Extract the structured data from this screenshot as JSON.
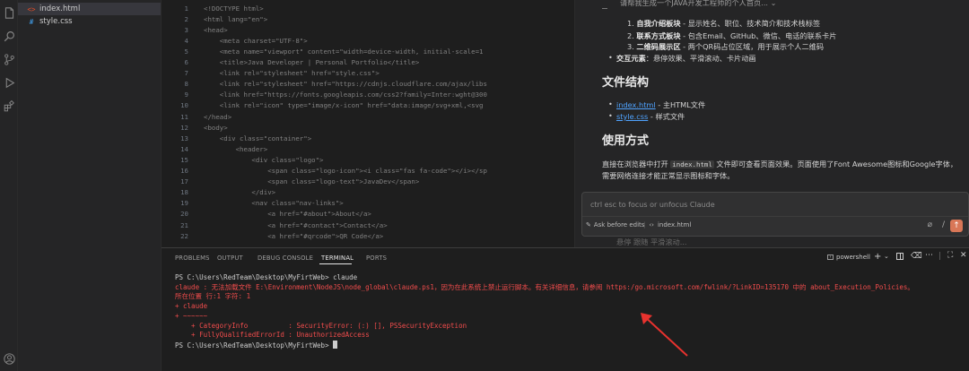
{
  "activity_bar": {
    "icons": [
      "files-icon",
      "search-icon",
      "source-control-icon",
      "run-debug-icon",
      "extensions-icon",
      "account-icon"
    ]
  },
  "explorer": {
    "files": [
      {
        "icon": "<>",
        "name": "index.html"
      },
      {
        "icon": "#",
        "name": "style.css"
      }
    ]
  },
  "editor": {
    "lines": [
      {
        "n": "1",
        "code": "<!DOCTYPE html>"
      },
      {
        "n": "2",
        "code": "<html lang=\"en\">"
      },
      {
        "n": "3",
        "code": "<head>"
      },
      {
        "n": "4",
        "code": "    <meta charset=\"UTF-8\">"
      },
      {
        "n": "5",
        "code": "    <meta name=\"viewport\" content=\"width=device-width, initial-scale=1"
      },
      {
        "n": "6",
        "code": "    <title>Java Developer | Personal Portfolio</title>"
      },
      {
        "n": "7",
        "code": "    <link rel=\"stylesheet\" href=\"style.css\">"
      },
      {
        "n": "8",
        "code": "    <link rel=\"stylesheet\" href=\"https://cdnjs.cloudflare.com/ajax/libs"
      },
      {
        "n": "9",
        "code": "    <link href=\"https://fonts.googleapis.com/css2?family=Inter:wght@300"
      },
      {
        "n": "10",
        "code": "    <link rel=\"icon\" type=\"image/x-icon\" href=\"data:image/svg+xml,<svg"
      },
      {
        "n": "11",
        "code": "</head>"
      },
      {
        "n": "12",
        "code": "<body>"
      },
      {
        "n": "13",
        "code": "    <div class=\"container\">"
      },
      {
        "n": "14",
        "code": "        <header>"
      },
      {
        "n": "15",
        "code": "            <div class=\"logo\">"
      },
      {
        "n": "16",
        "code": "                <span class=\"logo-icon\"><i class=\"fas fa-code\"></i></sp"
      },
      {
        "n": "17",
        "code": "                <span class=\"logo-text\">JavaDev</span>"
      },
      {
        "n": "18",
        "code": "            </div>"
      },
      {
        "n": "19",
        "code": "            <nav class=\"nav-links\">"
      },
      {
        "n": "20",
        "code": "                <a href=\"#about\">About</a>"
      },
      {
        "n": "21",
        "code": "                <a href=\"#contact\">Contact</a>"
      },
      {
        "n": "22",
        "code": "                <a href=\"#qrcode\">QR Code</a>"
      }
    ]
  },
  "chat": {
    "header_text": "请帮我生成一个JAVA开发工程师的个人首页...",
    "list_items": [
      {
        "num": "1.",
        "bold": "自我介绍板块",
        "text": " - 显示姓名、职位、技术简介和技术栈标签"
      },
      {
        "num": "2.",
        "bold": "联系方式板块",
        "text": " - 包含Email、GitHub、微信、电话的联系卡片"
      },
      {
        "num": "3.",
        "bold": "二维码展示区",
        "text": " - 两个QR码占位区域，用于展示个人二维码"
      }
    ],
    "interaction": {
      "bold": "交互元素",
      "text": "：悬停效果、平滑滚动、卡片动画"
    },
    "section1": "文件结构",
    "files": [
      {
        "link": "index.html",
        "text": " - 主HTML文件"
      },
      {
        "link": "style.css",
        "text": " - 样式文件"
      }
    ],
    "section2": "使用方式",
    "usage_pre": "直接在浏览器中打开 ",
    "usage_code": "index.html",
    "usage_post": " 文件即可查看页面效果。页面使用了Font Awesome图标和Google字体，",
    "usage_line2": "需要网络连接才能正常显示图标和字体。",
    "input_placeholder": "ctrl esc to focus or unfocus Claude",
    "ask_label": "Ask before edits",
    "file_chip": "index.html",
    "ghost_text": "悬停  跟随  平滑滚动..."
  },
  "panel": {
    "tabs": [
      "PROBLEMS",
      "OUTPUT",
      "DEBUG CONSOLE",
      "TERMINAL",
      "PORTS"
    ],
    "active_tab": "TERMINAL",
    "shell": "powershell",
    "terminal": [
      {
        "cls": "",
        "text": "PS C:\\Users\\RedTeam\\Desktop\\MyFirtWeb> claude"
      },
      {
        "cls": "err",
        "text": "claude : 无法加载文件 E:\\Environment\\NodeJS\\node_global\\claude.ps1，因为在此系统上禁止运行脚本。有关详细信息，请参阅 https:/go.microsoft.com/fwlink/?LinkID=135170 中的 about_Execution_Policies。"
      },
      {
        "cls": "err",
        "text": "所在位置 行:1 字符: 1"
      },
      {
        "cls": "err",
        "text": "+ claude"
      },
      {
        "cls": "err",
        "text": "+ ~~~~~~"
      },
      {
        "cls": "err",
        "text": "    + CategoryInfo          : SecurityError: (:) [], PSSecurityException"
      },
      {
        "cls": "err",
        "text": "    + FullyQualifiedErrorId : UnauthorizedAccess"
      },
      {
        "cls": "",
        "text": "PS C:\\Users\\RedTeam\\Desktop\\MyFirtWeb> "
      }
    ]
  },
  "colors": {
    "accent": "#d97757",
    "error": "#f14c4c",
    "link": "#4fa3ff",
    "arrow": "#e8322e"
  }
}
